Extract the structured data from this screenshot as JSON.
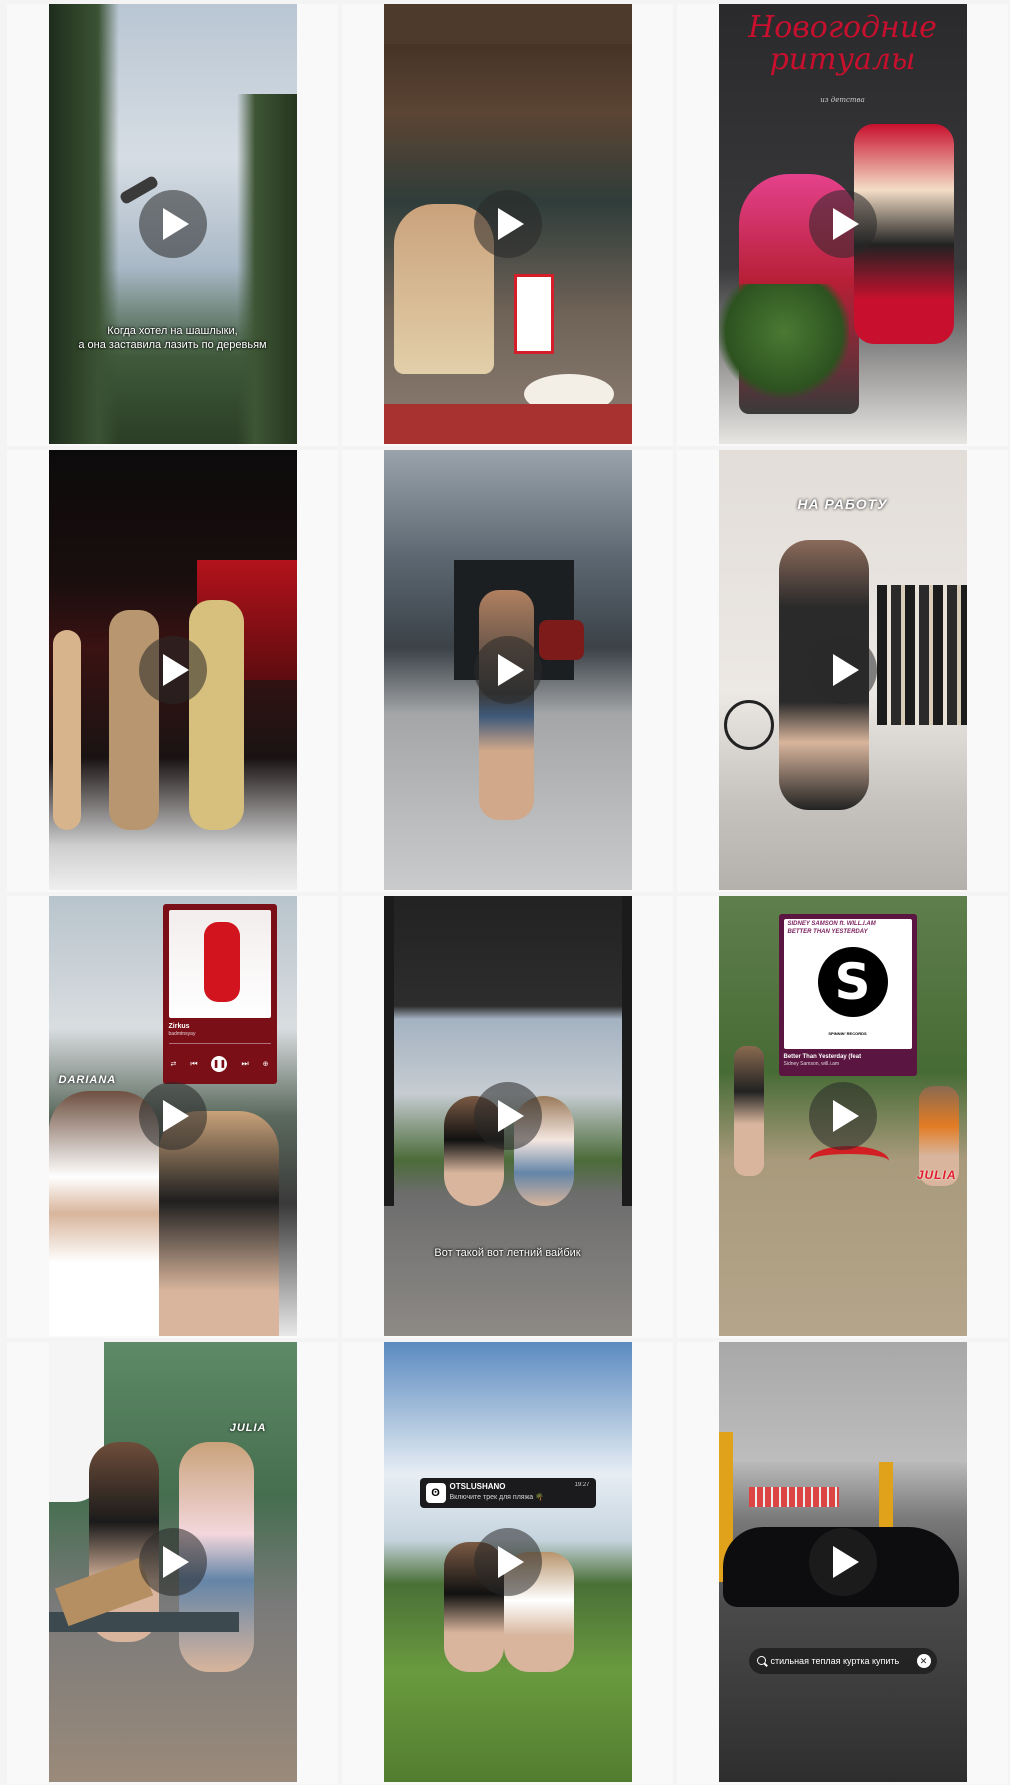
{
  "grid": {
    "videos": [
      {
        "caption": "Когда хотел на шашлыки,\nа она заставила лазить по деревьям"
      },
      {
        "caption": ""
      },
      {
        "title_line1": "Новогодние",
        "title_line2": "ритуалы",
        "subtitle": "из детства"
      },
      {
        "caption": ""
      },
      {
        "caption": ""
      },
      {
        "overlay": "НА РАБОТУ"
      },
      {
        "overlay": "DARIANA",
        "card_title": "Zirkus",
        "card_artist": "badmtnsyay"
      },
      {
        "caption": "Вот такой вот летний вайбик"
      },
      {
        "overlay": "JULIA",
        "card_header1": "SIDNEY SAMSON ft. WILL.I.AM",
        "card_header2": "BETTER THAN YESTERDAY",
        "card_label": "SPINNIN' RECORDS",
        "card_title": "Better Than Yesterday (feat",
        "card_artist": "Sidney Samson, will.i.am"
      },
      {
        "overlay": "JULIA"
      },
      {
        "notif_app": "OTSLUSHANO",
        "notif_text": "Включите трек для пляжа 🌴",
        "notif_time": "19:27"
      },
      {
        "search_text": "стильная теплая куртка купить"
      }
    ]
  },
  "colors": {
    "play_bg": "rgba(40,40,40,0.55)",
    "title_red": "#c8102e",
    "music_card_red": "#7a0f17",
    "music_card_purple": "#5a1640"
  }
}
